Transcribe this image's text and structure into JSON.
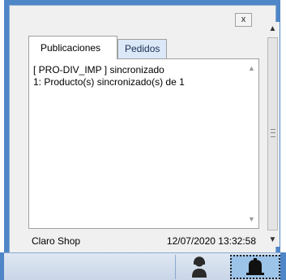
{
  "window": {
    "close_label": "x",
    "tabs": [
      {
        "label": "Publicaciones",
        "active": true
      },
      {
        "label": "Pedidos",
        "active": false
      }
    ],
    "log_lines": [
      "[ PRO-DIV_IMP ] sincronizado",
      "1: Producto(s) sincronizado(s) de 1"
    ],
    "status": {
      "store": "Claro Shop",
      "datetime": "12/07/2020 13:32:58"
    }
  },
  "taskbar": {
    "buttons": [
      {
        "icon": "agent-icon"
      },
      {
        "icon": "bell-icon"
      }
    ]
  },
  "colors": {
    "frame": "#4f86c7",
    "tab_inactive": "#dbe8f7",
    "bell_button_bg": "#9cc3e8"
  }
}
